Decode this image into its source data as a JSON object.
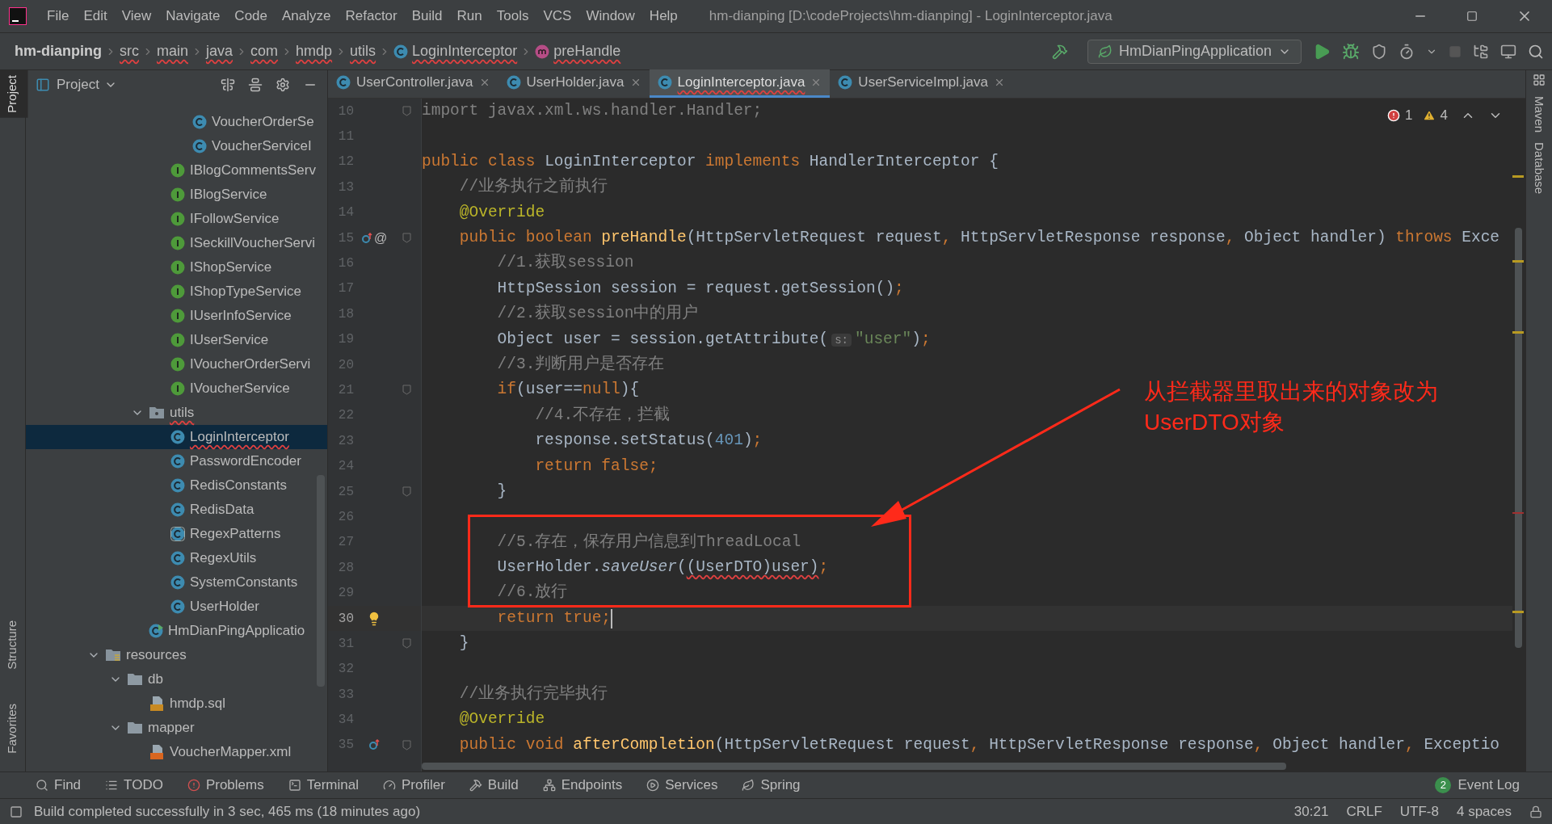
{
  "window": {
    "title": "hm-dianping [D:\\codeProjects\\hm-dianping] - LoginInterceptor.java"
  },
  "menu": [
    "File",
    "Edit",
    "View",
    "Navigate",
    "Code",
    "Analyze",
    "Refactor",
    "Build",
    "Run",
    "Tools",
    "VCS",
    "Window",
    "Help"
  ],
  "breadcrumbs": [
    {
      "label": "hm-dianping",
      "kind": "project"
    },
    {
      "label": "src",
      "kind": "folder"
    },
    {
      "label": "main",
      "kind": "folder"
    },
    {
      "label": "java",
      "kind": "folder"
    },
    {
      "label": "com",
      "kind": "folder"
    },
    {
      "label": "hmdp",
      "kind": "folder"
    },
    {
      "label": "utils",
      "kind": "folder"
    },
    {
      "label": "LoginInterceptor",
      "kind": "class"
    },
    {
      "label": "preHandle",
      "kind": "method"
    }
  ],
  "run_config": "HmDianPingApplication",
  "left_strip": [
    {
      "label": "Project",
      "selected": true
    },
    {
      "label": "Structure",
      "selected": false
    },
    {
      "label": "Favorites",
      "selected": false
    }
  ],
  "right_strip": [
    "Maven",
    "Database"
  ],
  "project_panel": {
    "title": "Project",
    "tree": [
      {
        "children": [
          {
            "children": [
              {
                "children": [
                  {
                    "children": [
                      {
                        "label": "VoucherOrderSe",
                        "kind": "class",
                        "selected": false,
                        "problem": false
                      },
                      {
                        "label": "VoucherServiceI",
                        "kind": "class",
                        "selected": false,
                        "problem": false
                      }
                    ]
                  },
                  {
                    "label": "IBlogCommentsServ",
                    "kind": "interface",
                    "selected": false,
                    "problem": false
                  },
                  {
                    "label": "IBlogService",
                    "kind": "interface",
                    "selected": false,
                    "problem": false
                  },
                  {
                    "label": "IFollowService",
                    "kind": "interface",
                    "selected": false,
                    "problem": false
                  },
                  {
                    "label": "ISeckillVoucherServi",
                    "kind": "interface",
                    "selected": false,
                    "problem": false
                  },
                  {
                    "label": "IShopService",
                    "kind": "interface",
                    "selected": false,
                    "problem": false
                  },
                  {
                    "label": "IShopTypeService",
                    "kind": "interface",
                    "selected": false,
                    "problem": false
                  },
                  {
                    "label": "IUserInfoService",
                    "kind": "interface",
                    "selected": false,
                    "problem": false
                  },
                  {
                    "label": "IUserService",
                    "kind": "interface",
                    "selected": false,
                    "problem": false
                  },
                  {
                    "label": "IVoucherOrderServi",
                    "kind": "interface",
                    "selected": false,
                    "problem": false
                  },
                  {
                    "label": "IVoucherService",
                    "kind": "interface",
                    "selected": false,
                    "problem": false
                  }
                ]
              },
              {
                "label": "utils",
                "kind": "package",
                "expanded": true,
                "selected": false,
                "problem": true,
                "children": [
                  {
                    "label": "LoginInterceptor",
                    "kind": "class",
                    "selected": true,
                    "problem": true
                  },
                  {
                    "label": "PasswordEncoder",
                    "kind": "class",
                    "selected": false,
                    "problem": false
                  },
                  {
                    "label": "RedisConstants",
                    "kind": "class",
                    "selected": false,
                    "problem": false
                  },
                  {
                    "label": "RedisData",
                    "kind": "class",
                    "selected": false,
                    "problem": false
                  },
                  {
                    "label": "RegexPatterns",
                    "kind": "abstract",
                    "selected": false,
                    "problem": false
                  },
                  {
                    "label": "RegexUtils",
                    "kind": "class",
                    "selected": false,
                    "problem": false
                  },
                  {
                    "label": "SystemConstants",
                    "kind": "class",
                    "selected": false,
                    "problem": false
                  },
                  {
                    "label": "UserHolder",
                    "kind": "class",
                    "selected": false,
                    "problem": false
                  }
                ]
              },
              {
                "label": "HmDianPingApplicatio",
                "kind": "app",
                "selected": false,
                "problem": false
              }
            ]
          }
        ]
      },
      {
        "label": "resources",
        "kind": "resources",
        "expanded": true,
        "selected": false,
        "problem": false,
        "children": [
          {
            "label": "db",
            "kind": "folder",
            "expanded": true,
            "selected": false,
            "problem": false,
            "children": [
              {
                "label": "hmdp.sql",
                "kind": "sql",
                "selected": false,
                "problem": false
              }
            ]
          },
          {
            "label": "mapper",
            "kind": "folder",
            "expanded": true,
            "selected": false,
            "problem": false,
            "children": [
              {
                "label": "VoucherMapper.xml",
                "kind": "xml",
                "selected": false,
                "problem": false
              }
            ]
          }
        ]
      }
    ]
  },
  "tabs": [
    {
      "label": "UserController.java",
      "selected": false,
      "problem": false
    },
    {
      "label": "UserHolder.java",
      "selected": false,
      "problem": false
    },
    {
      "label": "LoginInterceptor.java",
      "selected": true,
      "problem": true
    },
    {
      "label": "UserServiceImpl.java",
      "selected": false,
      "problem": false
    }
  ],
  "inspections": {
    "errors": "1",
    "warnings": "4"
  },
  "code": [
    {
      "number": "10",
      "fold": true,
      "override": false,
      "bulb": false,
      "current": false,
      "segments": [
        {
          "kind": "unused",
          "text": "import javax.xml.ws.handler.Handler;"
        }
      ]
    },
    {
      "number": "11",
      "fold": false,
      "override": false,
      "bulb": false,
      "current": false
    },
    {
      "number": "12",
      "fold": false,
      "override": false,
      "bulb": false,
      "current": false,
      "segments": [
        {
          "kind": "keyword",
          "text": "public class "
        },
        {
          "kind": "plain",
          "text": "LoginInterceptor "
        },
        {
          "kind": "keyword",
          "text": "implements "
        },
        {
          "kind": "plain",
          "text": "HandlerInterceptor {"
        }
      ]
    },
    {
      "number": "13",
      "fold": false,
      "override": false,
      "bulb": false,
      "current": false,
      "segments": [
        {
          "kind": "comment",
          "text": "    //业务执行之前执行"
        }
      ]
    },
    {
      "number": "14",
      "fold": false,
      "override": false,
      "bulb": false,
      "current": false,
      "segments": [
        {
          "kind": "annotation",
          "text": "    @Override"
        }
      ]
    },
    {
      "number": "15",
      "fold": true,
      "override": true,
      "bulb": false,
      "current": false,
      "gutter_text": "@",
      "segments": [
        {
          "kind": "keyword",
          "text": "    public boolean "
        },
        {
          "kind": "method",
          "text": "preHandle"
        },
        {
          "kind": "plain",
          "text": "(HttpServletRequest request"
        },
        {
          "kind": "keyword",
          "text": ", "
        },
        {
          "kind": "plain",
          "text": "HttpServletResponse response"
        },
        {
          "kind": "keyword",
          "text": ", "
        },
        {
          "kind": "plain",
          "text": "Object handler) "
        },
        {
          "kind": "keyword",
          "text": "throws "
        },
        {
          "kind": "plain",
          "text": "Exce"
        }
      ]
    },
    {
      "number": "16",
      "fold": false,
      "override": false,
      "bulb": false,
      "current": false,
      "segments": [
        {
          "kind": "comment",
          "text": "        //1.获取session"
        }
      ]
    },
    {
      "number": "17",
      "fold": false,
      "override": false,
      "bulb": false,
      "current": false,
      "segments": [
        {
          "kind": "plain",
          "text": "        HttpSession session = request.getSession()"
        },
        {
          "kind": "keyword",
          "text": ";"
        }
      ]
    },
    {
      "number": "18",
      "fold": false,
      "override": false,
      "bulb": false,
      "current": false,
      "segments": [
        {
          "kind": "comment",
          "text": "        //2.获取session中的用户"
        }
      ]
    },
    {
      "number": "19",
      "fold": false,
      "override": false,
      "bulb": false,
      "current": false,
      "segments": [
        {
          "kind": "plain",
          "text": "        Object user = session.getAttribute("
        },
        {
          "kind": "hint",
          "text": "s:"
        },
        {
          "kind": "string",
          "text": "\"user\""
        },
        {
          "kind": "plain",
          "text": ")"
        },
        {
          "kind": "keyword",
          "text": ";"
        }
      ]
    },
    {
      "number": "20",
      "fold": false,
      "override": false,
      "bulb": false,
      "current": false,
      "segments": [
        {
          "kind": "comment",
          "text": "        //3.判断用户是否存在"
        }
      ]
    },
    {
      "number": "21",
      "fold": true,
      "override": false,
      "bulb": false,
      "current": false,
      "segments": [
        {
          "kind": "keyword",
          "text": "        if"
        },
        {
          "kind": "plain",
          "text": "(user=="
        },
        {
          "kind": "keyword",
          "text": "null"
        },
        {
          "kind": "plain",
          "text": "){"
        }
      ]
    },
    {
      "number": "22",
      "fold": false,
      "override": false,
      "bulb": false,
      "current": false,
      "segments": [
        {
          "kind": "comment",
          "text": "            //4.不存在，拦截"
        }
      ]
    },
    {
      "number": "23",
      "fold": false,
      "override": false,
      "bulb": false,
      "current": false,
      "segments": [
        {
          "kind": "plain",
          "text": "            response.setStatus("
        },
        {
          "kind": "number",
          "text": "401"
        },
        {
          "kind": "plain",
          "text": ")"
        },
        {
          "kind": "keyword",
          "text": ";"
        }
      ]
    },
    {
      "number": "24",
      "fold": false,
      "override": false,
      "bulb": false,
      "current": false,
      "segments": [
        {
          "kind": "keyword",
          "text": "            return false;"
        }
      ]
    },
    {
      "number": "25",
      "fold": true,
      "override": false,
      "bulb": false,
      "current": false,
      "segments": [
        {
          "kind": "plain",
          "text": "        }"
        }
      ]
    },
    {
      "number": "26",
      "fold": false,
      "override": false,
      "bulb": false,
      "current": false
    },
    {
      "number": "27",
      "fold": false,
      "override": false,
      "bulb": false,
      "current": false,
      "segments": [
        {
          "kind": "comment",
          "text": "        //5.存在，保存用户信息到ThreadLocal"
        }
      ]
    },
    {
      "number": "28",
      "fold": false,
      "override": false,
      "bulb": false,
      "current": false,
      "segments": [
        {
          "kind": "plain",
          "text": "        UserHolder."
        },
        {
          "kind": "italic",
          "text": "saveUser"
        },
        {
          "kind": "plain",
          "text": "("
        },
        {
          "kind": "error",
          "text": "(UserDTO)user)"
        },
        {
          "kind": "keyword",
          "text": ";"
        }
      ]
    },
    {
      "number": "29",
      "fold": false,
      "override": false,
      "bulb": false,
      "current": false,
      "segments": [
        {
          "kind": "comment",
          "text": "        //6.放行"
        }
      ]
    },
    {
      "number": "30",
      "fold": false,
      "override": false,
      "bulb": true,
      "current": true,
      "segments": [
        {
          "kind": "keyword",
          "text": "        return true;"
        }
      ]
    },
    {
      "number": "31",
      "fold": true,
      "override": false,
      "bulb": false,
      "current": false,
      "segments": [
        {
          "kind": "plain",
          "text": "    }"
        }
      ]
    },
    {
      "number": "32",
      "fold": false,
      "override": false,
      "bulb": false,
      "current": false
    },
    {
      "number": "33",
      "fold": false,
      "override": false,
      "bulb": false,
      "current": false,
      "segments": [
        {
          "kind": "comment",
          "text": "    //业务执行完毕执行"
        }
      ]
    },
    {
      "number": "34",
      "fold": false,
      "override": false,
      "bulb": false,
      "current": false,
      "segments": [
        {
          "kind": "annotation",
          "text": "    @Override"
        }
      ]
    },
    {
      "number": "35",
      "fold": true,
      "override": true,
      "bulb": false,
      "current": false,
      "segments": [
        {
          "kind": "keyword",
          "text": "    public void "
        },
        {
          "kind": "method",
          "text": "afterCompletion"
        },
        {
          "kind": "plain",
          "text": "(HttpServletRequest request"
        },
        {
          "kind": "keyword",
          "text": ", "
        },
        {
          "kind": "plain",
          "text": "HttpServletResponse response"
        },
        {
          "kind": "keyword",
          "text": ", "
        },
        {
          "kind": "plain",
          "text": "Object handler"
        },
        {
          "kind": "keyword",
          "text": ", "
        },
        {
          "kind": "plain",
          "text": "Exceptio"
        }
      ]
    }
  ],
  "annotation": {
    "lines": [
      "从拦截器里取出来的对象改为",
      "UserDTO对象"
    ]
  },
  "bottom_tools": [
    {
      "label": "Find",
      "kind": "find"
    },
    {
      "label": "TODO",
      "kind": "todo"
    },
    {
      "label": "Problems",
      "kind": "problems"
    },
    {
      "label": "Terminal",
      "kind": "terminal"
    },
    {
      "label": "Profiler",
      "kind": "profiler"
    },
    {
      "label": "Build",
      "kind": "build"
    },
    {
      "label": "Endpoints",
      "kind": "endpoints"
    },
    {
      "label": "Services",
      "kind": "services"
    },
    {
      "label": "Spring",
      "kind": "spring"
    }
  ],
  "event_log": {
    "label": "Event Log",
    "count": "2"
  },
  "status_bar": {
    "message": "Build completed successfully in 3 sec, 465 ms (18 minutes ago)",
    "position": "30:21",
    "line_separator": "CRLF",
    "encoding": "UTF-8",
    "indent": "4 spaces"
  }
}
